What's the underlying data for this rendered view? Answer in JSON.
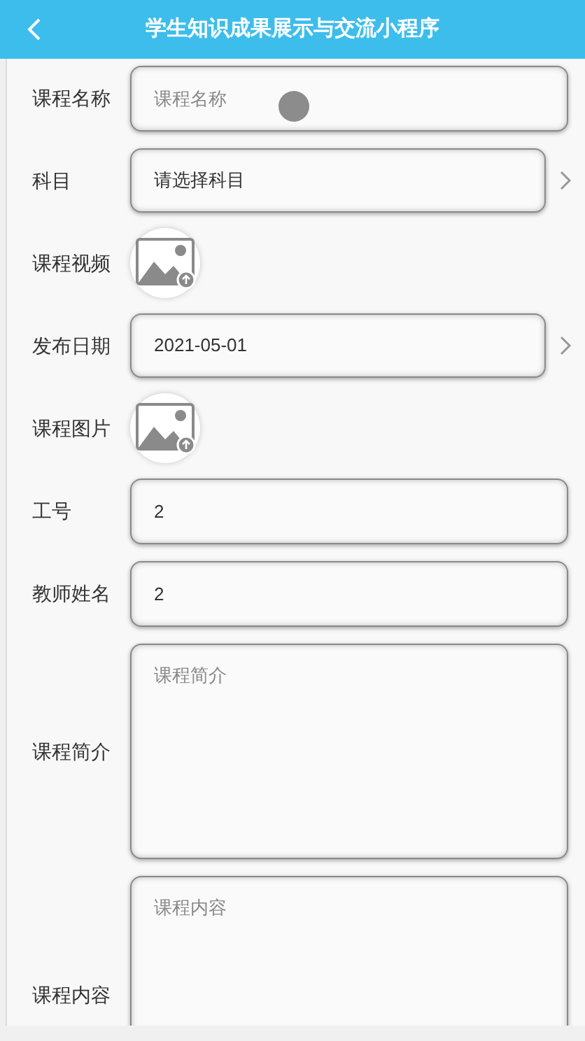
{
  "header": {
    "title": "学生知识成果展示与交流小程序"
  },
  "fields": [
    {
      "kind": "input",
      "label": "课程名称",
      "placeholder": "课程名称",
      "pointer": true
    },
    {
      "kind": "select",
      "label": "科目",
      "value": "请选择科目"
    },
    {
      "kind": "media",
      "label": "课程视频"
    },
    {
      "kind": "select",
      "label": "发布日期",
      "value": "2021-05-01"
    },
    {
      "kind": "media",
      "label": "课程图片"
    },
    {
      "kind": "input",
      "label": "工号",
      "value": "2"
    },
    {
      "kind": "input",
      "label": "教师姓名",
      "value": "2"
    },
    {
      "kind": "textarea",
      "label": "课程简介",
      "placeholder": "课程简介"
    },
    {
      "kind": "textarea",
      "label": "课程内容",
      "placeholder": "课程内容"
    }
  ]
}
